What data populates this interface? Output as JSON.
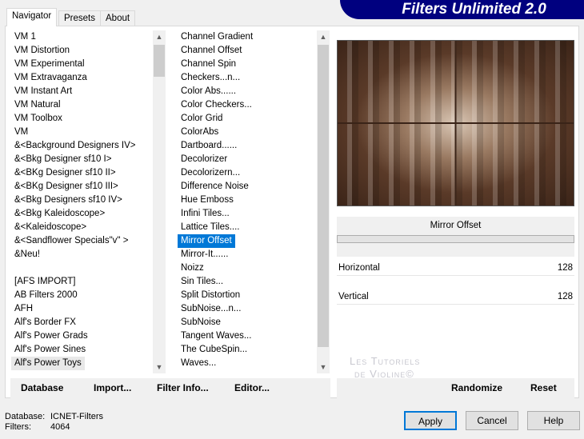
{
  "tabs": [
    "Navigator",
    "Presets",
    "About"
  ],
  "banner": "Filters Unlimited 2.0",
  "categories": [
    "VM 1",
    "VM Distortion",
    "VM Experimental",
    "VM Extravaganza",
    "VM Instant Art",
    "VM Natural",
    "VM Toolbox",
    "VM",
    "&<Background Designers IV>",
    "&<Bkg Designer sf10 I>",
    "&<BKg Designer sf10 II>",
    "&<BKg Designer sf10 III>",
    "&<Bkg Designers sf10 IV>",
    "&<Bkg Kaleidoscope>",
    "&<Kaleidoscope>",
    "&<Sandflower Specials\"v\" >",
    "&Neu!",
    "",
    "[AFS IMPORT]",
    "AB Filters 2000",
    "AFH",
    "Alf's Border FX",
    "Alf's Power Grads",
    "Alf's Power Sines",
    "Alf's Power Toys"
  ],
  "selected_category": "Alf's Power Toys",
  "filters": [
    "Channel Gradient",
    "Channel Offset",
    "Channel Spin",
    "Checkers...n...",
    "Color Abs......",
    "Color Checkers...",
    "Color Grid",
    "ColorAbs",
    "Dartboard......",
    "Decolorizer",
    "Decolorizern...",
    "Difference Noise",
    "Hue Emboss",
    "Infini Tiles...",
    "Lattice Tiles....",
    "Mirror Offset",
    "Mirror-It......",
    "Noizz",
    "Sin Tiles...",
    "Split Distortion",
    "SubNoise...n...",
    "SubNoise",
    "Tangent Waves...",
    "The CubeSpin...",
    "Waves..."
  ],
  "selected_filter": "Mirror Offset",
  "buttons": {
    "database": "Database",
    "import": "Import...",
    "filter_info": "Filter Info...",
    "editor": "Editor...",
    "randomize": "Randomize",
    "reset": "Reset",
    "apply": "Apply",
    "cancel": "Cancel",
    "help": "Help"
  },
  "filter_title": "Mirror Offset",
  "params": [
    {
      "label": "Horizontal",
      "value": "128"
    },
    {
      "label": "Vertical",
      "value": "128"
    }
  ],
  "watermark": [
    "Les Tutoriels",
    "de Violine©"
  ],
  "status": {
    "database_label": "Database:",
    "database_value": "ICNET-Filters",
    "filters_label": "Filters:",
    "filters_value": "4064"
  }
}
